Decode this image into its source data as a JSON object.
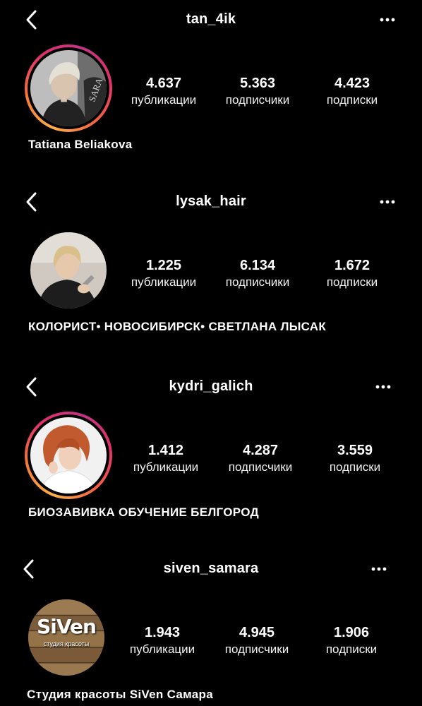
{
  "profiles": [
    {
      "username": "tan_4ik",
      "posts": "4.637",
      "followers": "5.363",
      "following": "4.423",
      "posts_label": "публикации",
      "followers_label": "подписчики",
      "following_label": "подписки",
      "bio_name": "Tatiana Beliakova",
      "has_story": true,
      "avatar_icon": "woman-short-hair-photo"
    },
    {
      "username": "lysak_hair",
      "posts": "1.225",
      "followers": "6.134",
      "following": "1.672",
      "posts_label": "публикации",
      "followers_label": "подписчики",
      "following_label": "подписки",
      "bio_name": "КОЛОРИСТ• НОВОСИБИРСК• СВЕТЛАНА ЛЫСАК",
      "has_story": false,
      "avatar_icon": "blonde-woman-with-scissors-photo"
    },
    {
      "username": "kydri_galich",
      "posts": "1.412",
      "followers": "4.287",
      "following": "3.559",
      "posts_label": "публикации",
      "followers_label": "подписчики",
      "following_label": "подписки",
      "bio_name": "БИОЗАВИВКА ОБУЧЕНИЕ БЕЛГОРОД",
      "has_story": true,
      "avatar_icon": "curly-red-hair-woman-photo"
    },
    {
      "username": "siven_samara",
      "posts": "1.943",
      "followers": "4.945",
      "following": "1.906",
      "posts_label": "публикации",
      "followers_label": "подписчики",
      "following_label": "подписки",
      "bio_name": "Студия красоты SiVen Самара",
      "has_story": false,
      "avatar_icon": "siven-logo-wood",
      "logo_text": "SiVen",
      "logo_subtext": "студия красоты"
    }
  ],
  "colors": {
    "background": "#000000",
    "text": "#ffffff",
    "story_ring_start": "#fcaf45",
    "story_ring_end": "#c13584"
  },
  "icons": {
    "back": "chevron-left-icon",
    "more": "more-horizontal-icon"
  }
}
